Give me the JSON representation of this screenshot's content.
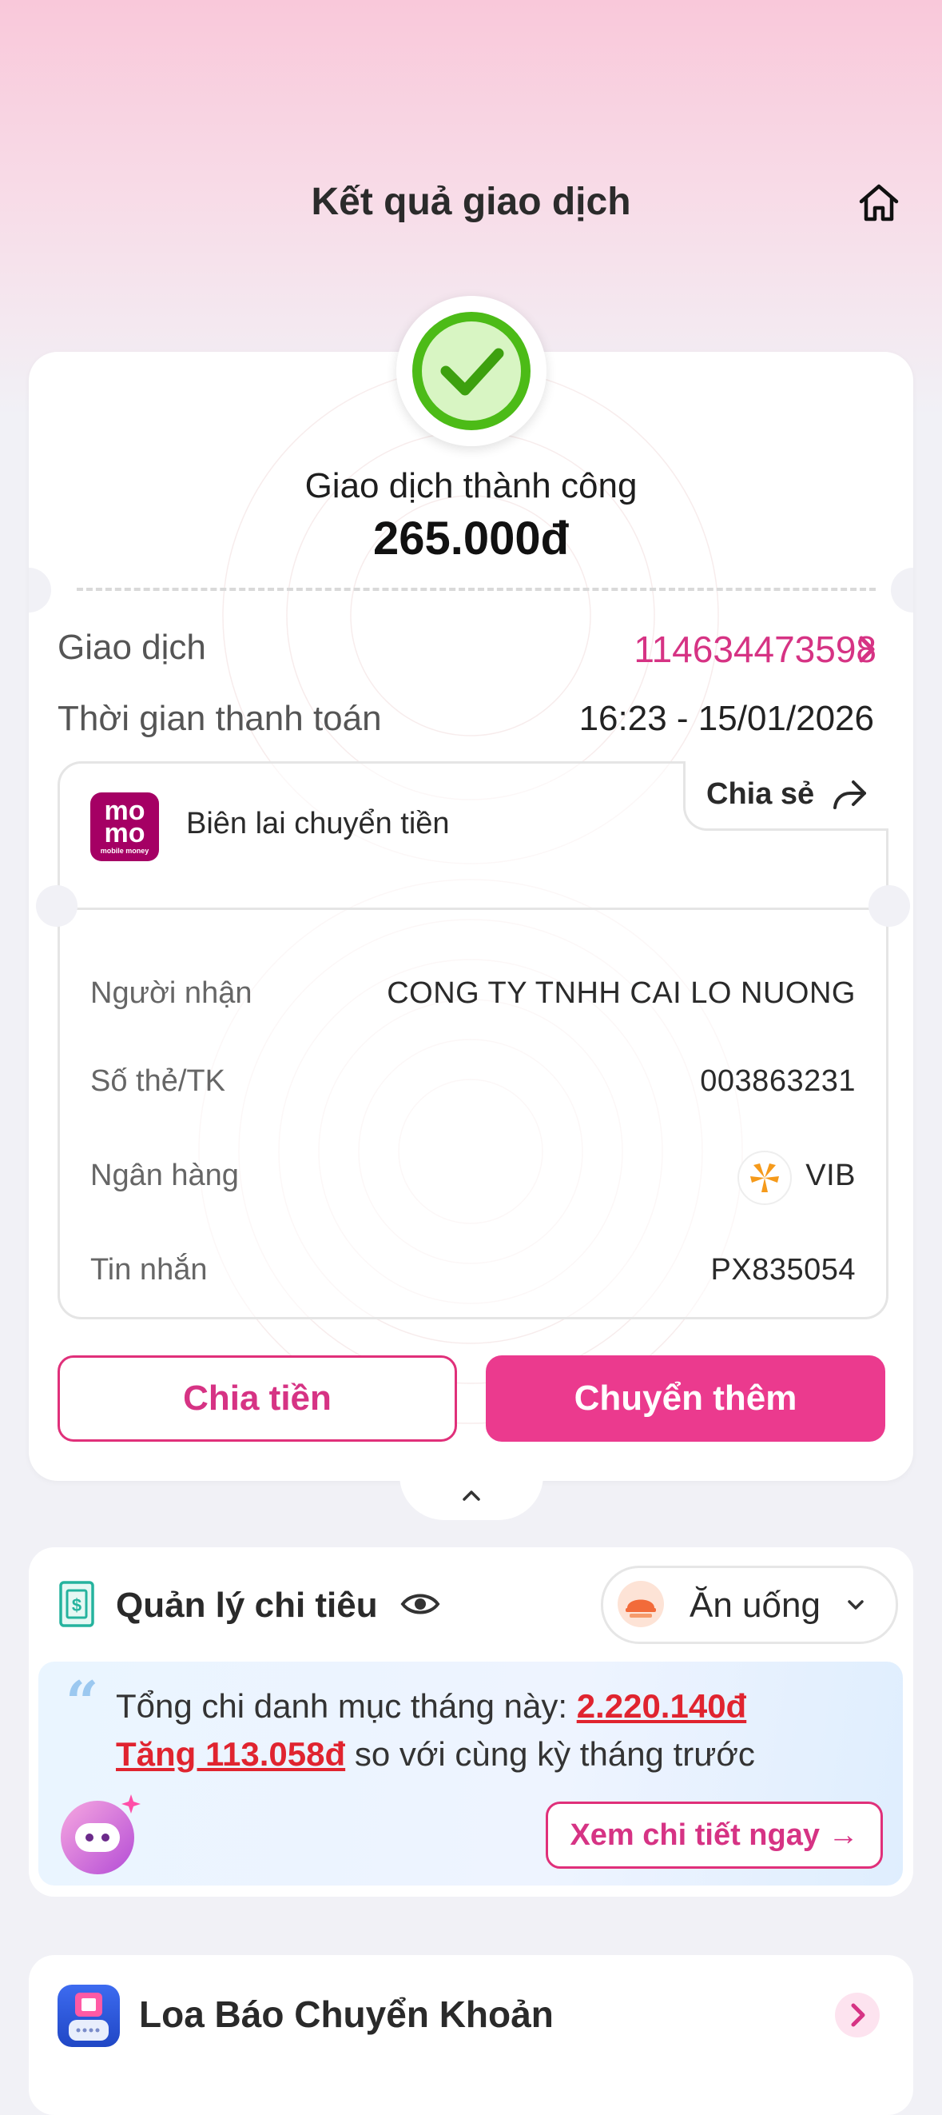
{
  "header": {
    "title": "Kết quả giao dịch"
  },
  "result": {
    "status": "Giao dịch thành công",
    "amount": "265.000đ"
  },
  "transaction": {
    "id_label": "Giao dịch",
    "id_value": "114634473598",
    "time_label": "Thời gian thanh toán",
    "time_value": "16:23 - 15/01/2026"
  },
  "receipt": {
    "logo_top": "mo",
    "logo_bottom": "mo",
    "logo_caption": "mobile money",
    "title": "Biên lai chuyển tiền",
    "share_label": "Chia sẻ",
    "rows": [
      {
        "label": "Người nhận",
        "value": "CONG TY TNHH CAI LO NUONG"
      },
      {
        "label": "Số thẻ/TK",
        "value": "003863231"
      },
      {
        "label": "Ngân hàng",
        "value": "VIB"
      },
      {
        "label": "Tin nhắn",
        "value": "PX835054"
      }
    ]
  },
  "actions": {
    "split_label": "Chia tiền",
    "transfer_more_label": "Chuyển thêm"
  },
  "spending": {
    "title": "Quản lý chi tiêu",
    "category": "Ăn uống",
    "line1_prefix": "Tổng chi danh mục tháng này: ",
    "line1_amount": "2.220.140đ",
    "line2_amount": "Tăng 113.058đ",
    "line2_suffix": " so với cùng kỳ tháng trước",
    "detail_button": "Xem chi tiết ngay →"
  },
  "loa": {
    "title": "Loa Báo Chuyển Khoản"
  },
  "colors": {
    "brand_pink": "#eb3a8e",
    "success_green": "#4cbb17",
    "alert_red": "#e0242f"
  }
}
